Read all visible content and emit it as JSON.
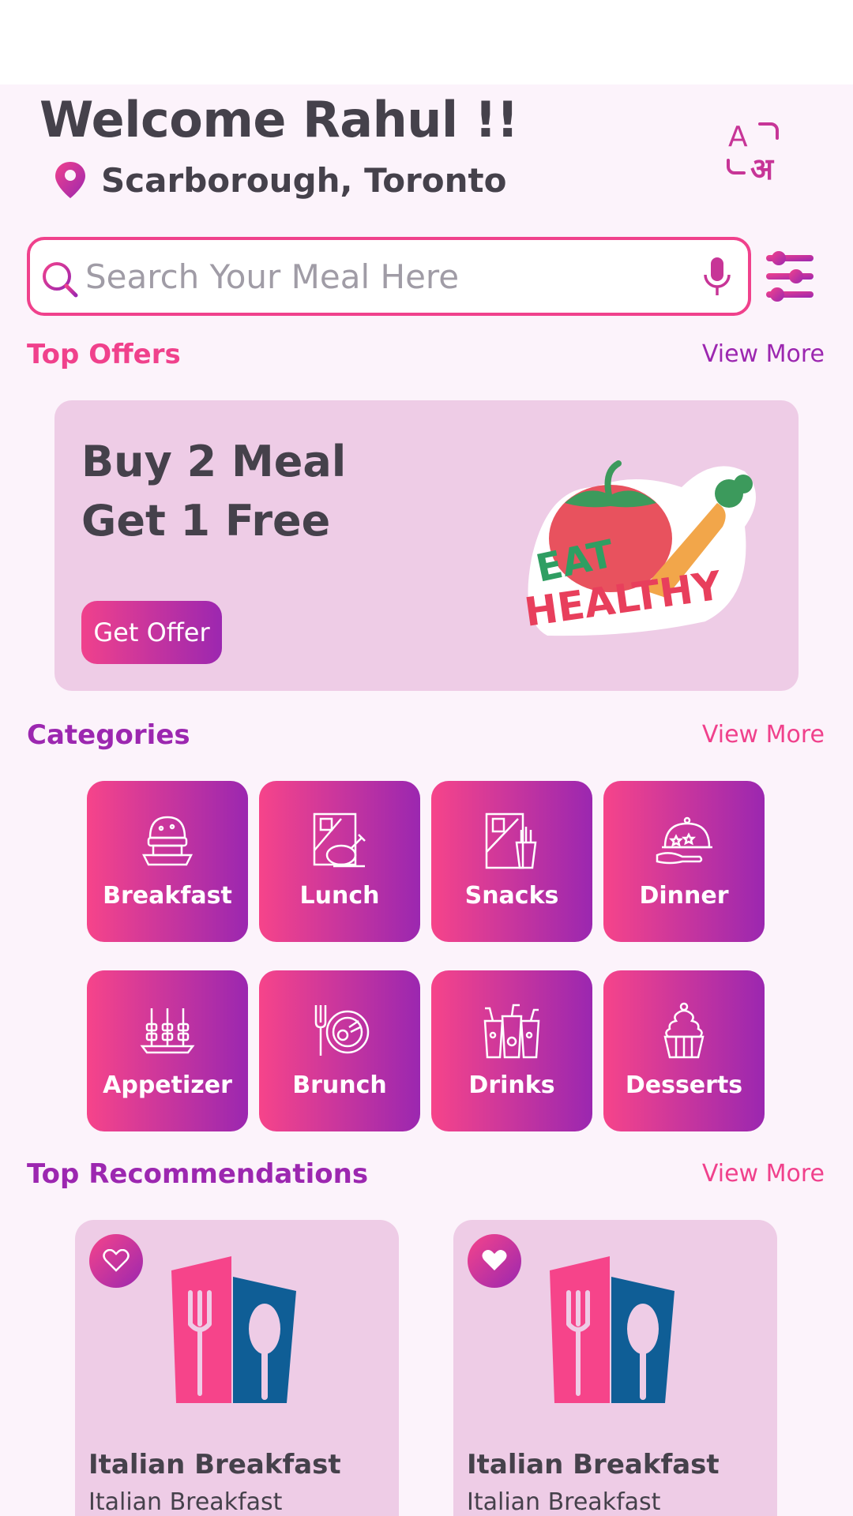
{
  "header": {
    "welcome": "Welcome Rahul !!",
    "location": "Scarborough, Toronto"
  },
  "search": {
    "placeholder": "Search Your Meal Here",
    "value": ""
  },
  "top_offers": {
    "title": "Top Offers",
    "view_more": "View More",
    "offer_line1": "Buy 2 Meal",
    "offer_line2": "Get 1 Free",
    "button": "Get Offer",
    "sticker_line1": "EAT",
    "sticker_line2": "HEALTHY"
  },
  "categories": {
    "title": "Categories",
    "view_more": "View More",
    "items": [
      {
        "label": "Breakfast",
        "icon": "breakfast-icon"
      },
      {
        "label": "Lunch",
        "icon": "lunch-icon"
      },
      {
        "label": "Snacks",
        "icon": "snacks-icon"
      },
      {
        "label": "Dinner",
        "icon": "dinner-icon"
      },
      {
        "label": "Appetizer",
        "icon": "appetizer-icon"
      },
      {
        "label": "Brunch",
        "icon": "brunch-icon"
      },
      {
        "label": "Drinks",
        "icon": "drinks-icon"
      },
      {
        "label": "Desserts",
        "icon": "desserts-icon"
      }
    ]
  },
  "recommendations": {
    "title": "Top Recommendations",
    "view_more": "View More",
    "items": [
      {
        "name": "Italian Breakfast",
        "subtitle": "Italian Breakfast",
        "favorited": false
      },
      {
        "name": "Italian Breakfast",
        "subtitle": "Italian Breakfast",
        "favorited": true
      }
    ]
  },
  "colors": {
    "primary_pink": "#f0418c",
    "primary_purple": "#9c27b0",
    "text_dark": "#45414b",
    "card_bg": "#eecce6",
    "screen_bg": "#fcf3fb"
  }
}
